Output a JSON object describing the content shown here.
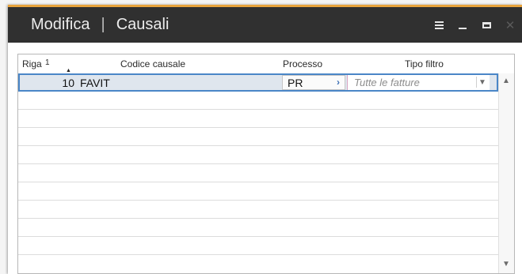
{
  "window": {
    "title": "Modifica",
    "separator": "|",
    "subtitle": "Causali",
    "accent_color": "#e8a33c",
    "titlebar_color": "#303030",
    "icons": [
      "menu-icon",
      "minimize-icon",
      "maximize-icon",
      "close-icon"
    ],
    "close_glyph": "✕"
  },
  "grid": {
    "columns": [
      {
        "label": "Riga",
        "sort": "1"
      },
      {
        "label": "Codice causale"
      },
      {
        "label": "Processo"
      },
      {
        "label": "Tipo filtro"
      }
    ],
    "rows": [
      {
        "riga": "10",
        "codice": "FAVIT",
        "processo": "PR",
        "tipo_filtro_placeholder": "Tutte le fatture"
      }
    ],
    "selection_color": "#4a86c7"
  },
  "glyphs": {
    "sort_up": "▲",
    "arrow_right": "›",
    "dropdown": "▼",
    "scroll_up": "▲",
    "scroll_down": "▼"
  }
}
